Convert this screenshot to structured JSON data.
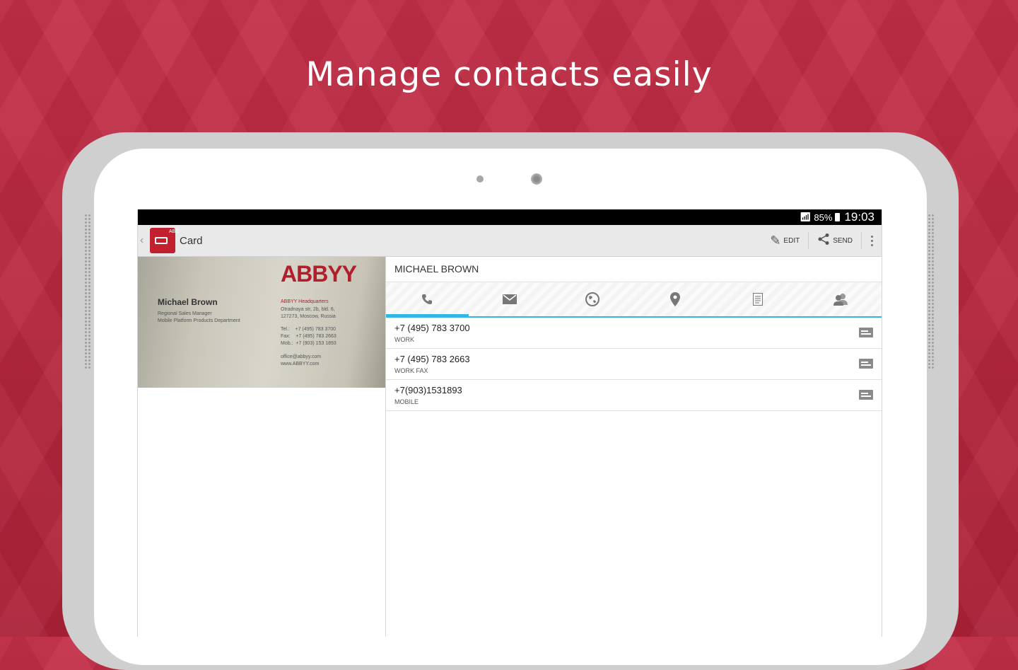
{
  "headline": "Manage contacts easily",
  "status_bar": {
    "battery": "85%",
    "time": "19:03"
  },
  "action_bar": {
    "title": "Card",
    "app_icon_letters": "ABC",
    "edit_label": "EDIT",
    "send_label": "SEND"
  },
  "card_image": {
    "logo": "ABBYY",
    "name": "Michael Brown",
    "job_lines": "Regional Sales Manager\nMobile Platform Products Department",
    "hq": "ABBYY Headquarters",
    "address": "Otradnaya str, 2b, bld. 6,\n127273, Moscow, Russia",
    "phones": "Tel.:    +7 (495) 783 3700\nFax:    +7 (495) 783 2663\nMob.:  +7 (903) 153 1893",
    "web": "office@abbyy.com\nwww.ABBYY.com"
  },
  "contact": {
    "name": "MICHAEL BROWN",
    "tabs": [
      {
        "icon": "phone-icon",
        "active": true
      },
      {
        "icon": "email-icon",
        "active": false
      },
      {
        "icon": "globe-icon",
        "active": false
      },
      {
        "icon": "location-pin-icon",
        "active": false
      },
      {
        "icon": "note-icon",
        "active": false
      },
      {
        "icon": "contacts-icon",
        "active": false
      }
    ],
    "phones": [
      {
        "number": "+7 (495) 783 3700",
        "type": "WORK"
      },
      {
        "number": "+7 (495) 783 2663",
        "type": "WORK FAX"
      },
      {
        "number": "+7(903)1531893",
        "type": "MOBILE"
      }
    ]
  },
  "colors": {
    "background": "#c0253e",
    "accent": "#33b5e5",
    "brand": "#c2202f"
  }
}
